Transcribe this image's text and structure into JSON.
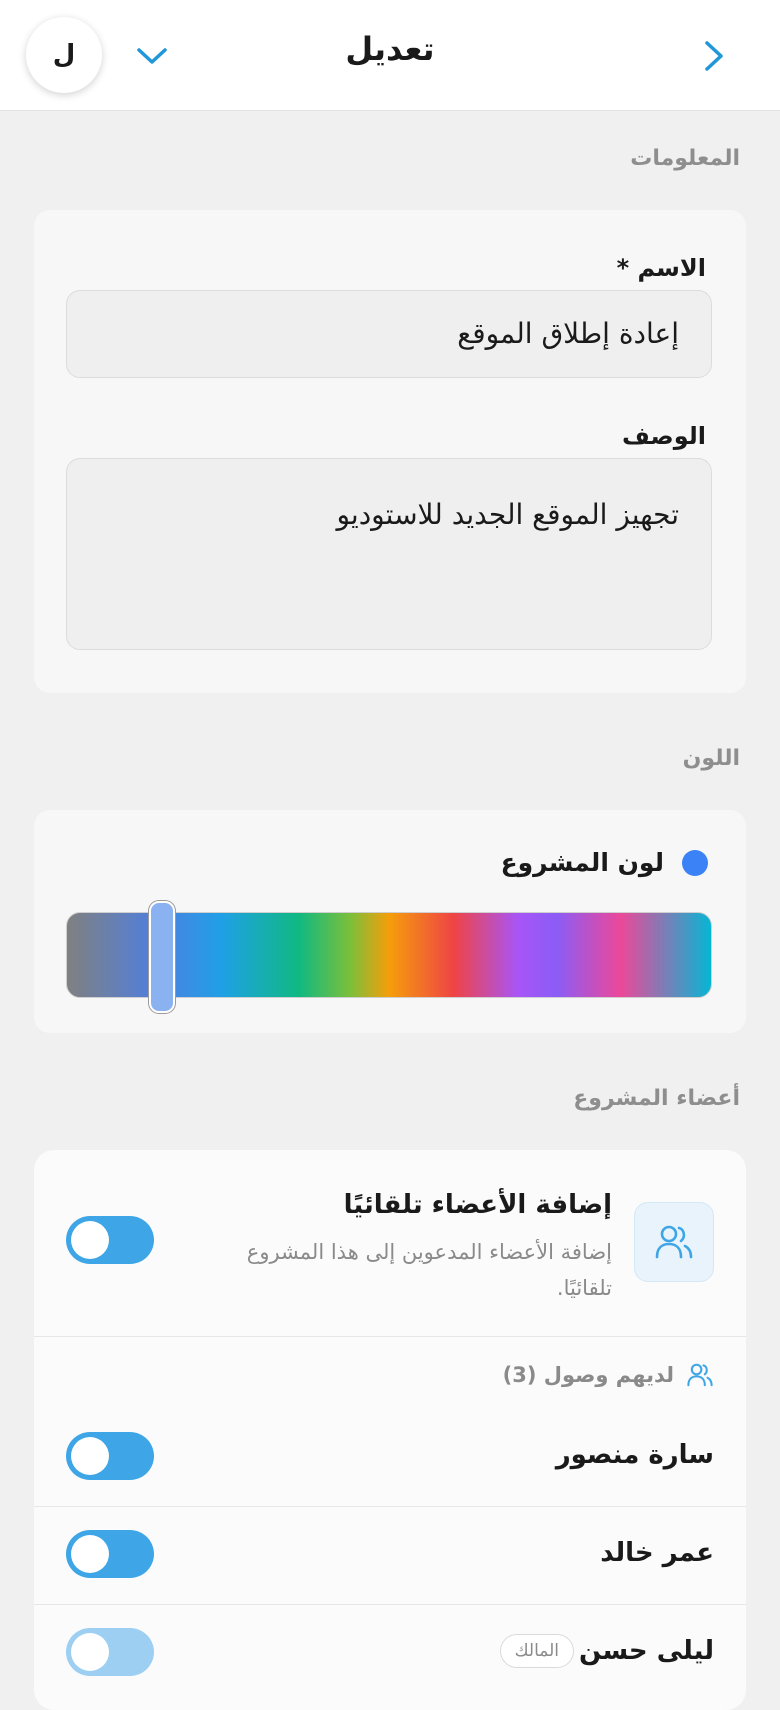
{
  "header": {
    "title": "تعديل",
    "avatar_initial": "ل",
    "back_icon": "chevron-right-icon",
    "menu_icon": "chevron-down-icon"
  },
  "info_section": {
    "label": "المعلومات",
    "name_label": "الاسم *",
    "name_value": "إعادة إطلاق الموقع",
    "description_label": "الوصف",
    "description_value": "تجهيز الموقع الجديد للاستوديو"
  },
  "color_section": {
    "label": "اللون",
    "project_color_label": "لون المشروع",
    "selected_color": "#3b82f6",
    "hue_position": 0.145
  },
  "members_section": {
    "label": "أعضاء المشروع",
    "auto_add": {
      "title": "إضافة الأعضاء تلقائيًا",
      "description": "إضافة الأعضاء المدعوين إلى هذا المشروع تلقائيًا.",
      "icon": "users-icon"
    },
    "access_label": "لديهم وصول (3)",
    "members": [
      {
        "name": "سارة منصور",
        "badge": ""
      },
      {
        "name": "عمر خالد",
        "badge": ""
      },
      {
        "name": "ليلى حسن",
        "badge": "المالك"
      }
    ]
  },
  "colors": {
    "accent": "#3ea6e6",
    "link": "#2196d8"
  }
}
